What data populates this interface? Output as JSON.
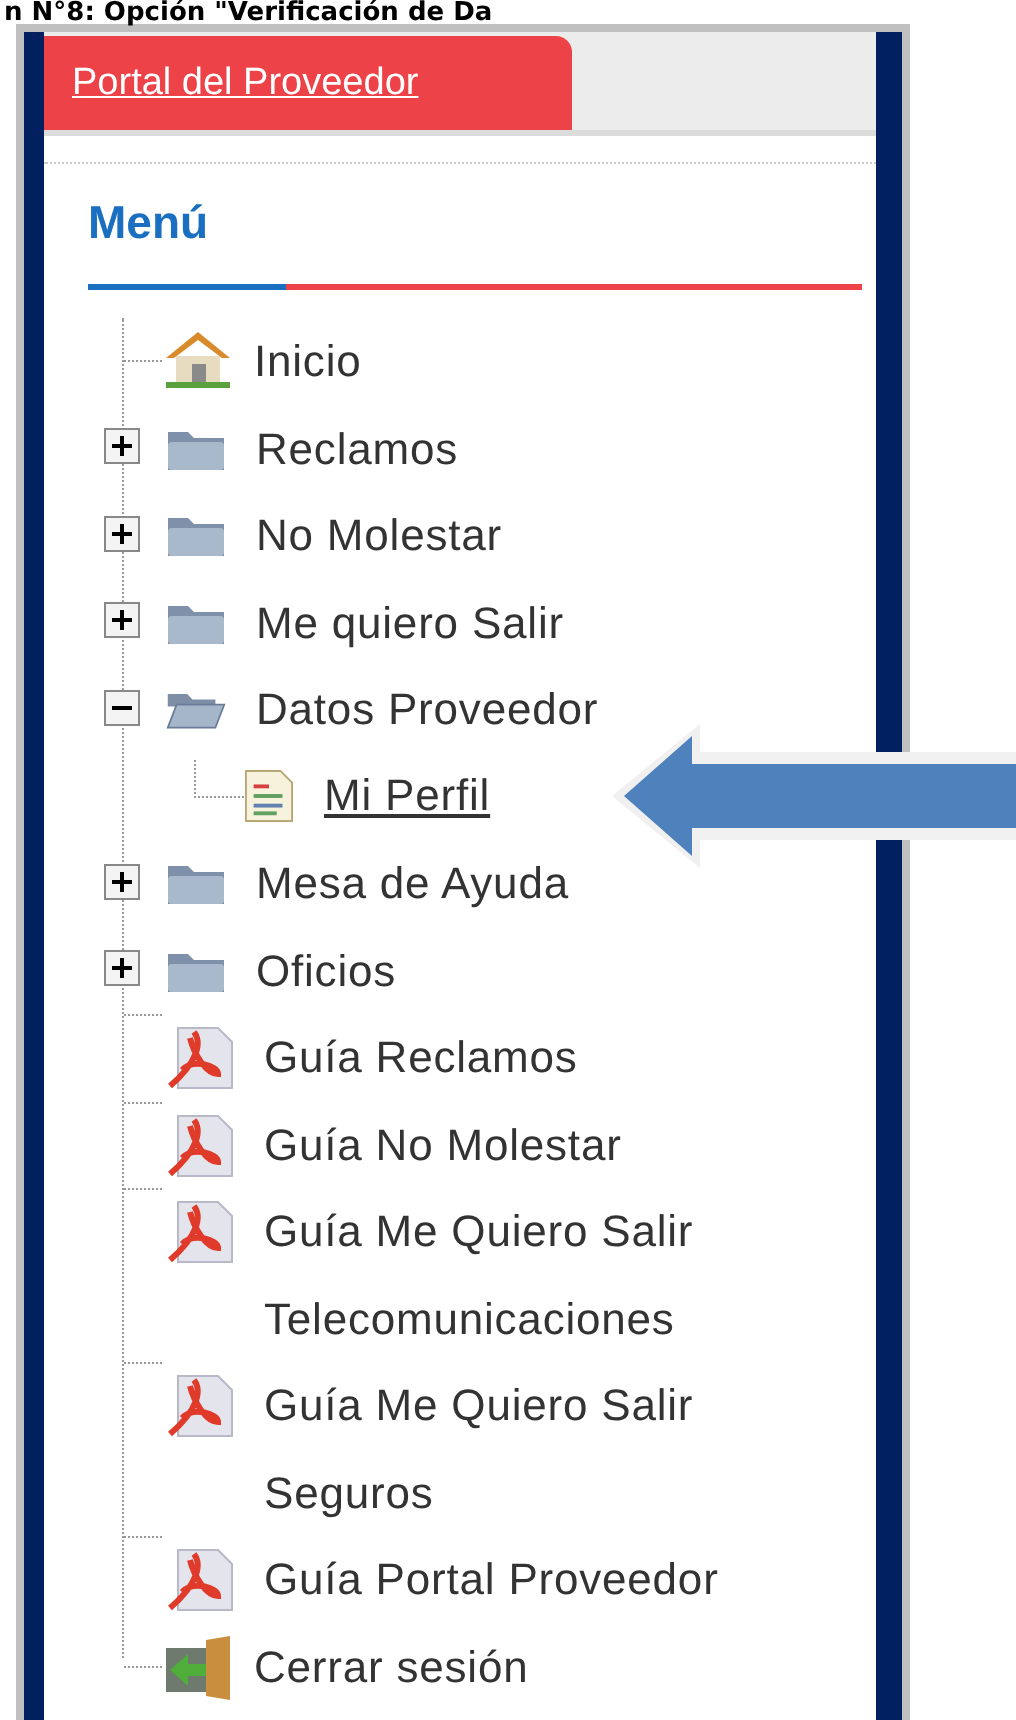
{
  "caption": "n N°8: Opción \"Verificación de Da",
  "tab": {
    "label": "Portal del Proveedor",
    "selected": true
  },
  "menu": {
    "title": "Menú"
  },
  "tree": [
    {
      "kind": "home",
      "label": "Inicio"
    },
    {
      "kind": "folder",
      "label": "Reclamos",
      "expanded": false
    },
    {
      "kind": "folder",
      "label": "No Molestar",
      "expanded": false
    },
    {
      "kind": "folder",
      "label": "Me quiero Salir",
      "expanded": false
    },
    {
      "kind": "folder",
      "label": "Datos Proveedor",
      "expanded": true,
      "children": [
        {
          "kind": "document",
          "label": "Mi Perfil"
        }
      ]
    },
    {
      "kind": "folder",
      "label": "Mesa de Ayuda",
      "expanded": false
    },
    {
      "kind": "folder",
      "label": "Oficios",
      "expanded": false
    },
    {
      "kind": "pdf",
      "label": "Guía Reclamos"
    },
    {
      "kind": "pdf",
      "label": "Guía No Molestar"
    },
    {
      "kind": "pdf",
      "label": "Guía Me Quiero Salir Telecomunicaciones"
    },
    {
      "kind": "pdf",
      "label": "Guía Me Quiero Salir Seguros"
    },
    {
      "kind": "pdf",
      "label": "Guía Portal Proveedor"
    },
    {
      "kind": "logout",
      "label": "Cerrar sesión"
    }
  ]
}
